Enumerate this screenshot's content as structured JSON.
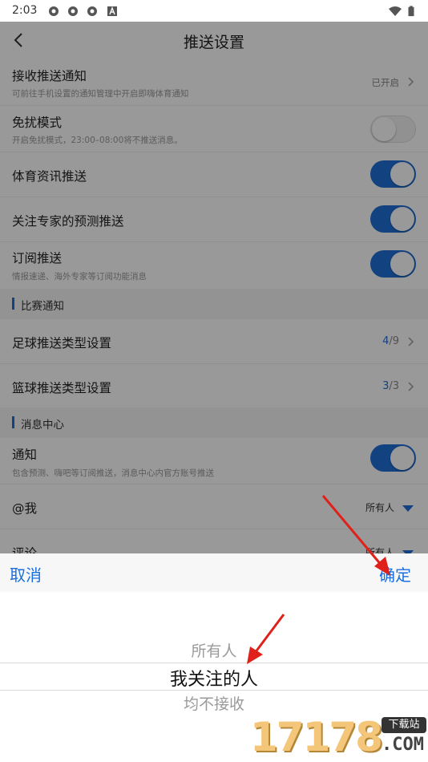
{
  "status_bar": {
    "time": "2:03"
  },
  "nav": {
    "title": "推送设置"
  },
  "rows": {
    "receive": {
      "label": "接收推送通知",
      "sub": "可前往手机设置的通知管理中开启即嗨体育通知",
      "value": "已开启"
    },
    "dnd": {
      "label": "免扰模式",
      "sub": "开启免扰模式，23:00–08:00将不推送消息。",
      "enabled": false
    },
    "sports_news": {
      "label": "体育资讯推送",
      "enabled": true
    },
    "expert": {
      "label": "关注专家的预测推送",
      "enabled": true
    },
    "subscribe": {
      "label": "订阅推送",
      "sub": "情报速递、海外专家等订阅功能消息",
      "enabled": true
    },
    "football": {
      "label": "足球推送类型设置",
      "selected": "4",
      "total": "/9"
    },
    "basketball": {
      "label": "篮球推送类型设置",
      "selected": "3",
      "total": "/3"
    },
    "notice": {
      "label": "通知",
      "sub": "包含预测、嗨吧等订阅推送，消息中心内官方账号推送",
      "enabled": true
    },
    "mention": {
      "label": "@我",
      "value": "所有人"
    },
    "comment": {
      "label": "评论",
      "value": "所有人"
    }
  },
  "sections": {
    "match": "比赛通知",
    "message": "消息中心"
  },
  "picker": {
    "cancel": "取消",
    "confirm": "确定",
    "options": [
      "所有人",
      "我关注的人",
      "均不接收"
    ],
    "selected_index": 1
  },
  "watermark": {
    "digits": "17178",
    "com": ".COM",
    "badge": "下载站"
  },
  "colors": {
    "accent": "#1e6fd6",
    "link": "#1a6fe0",
    "annotation": "#e0201a"
  }
}
